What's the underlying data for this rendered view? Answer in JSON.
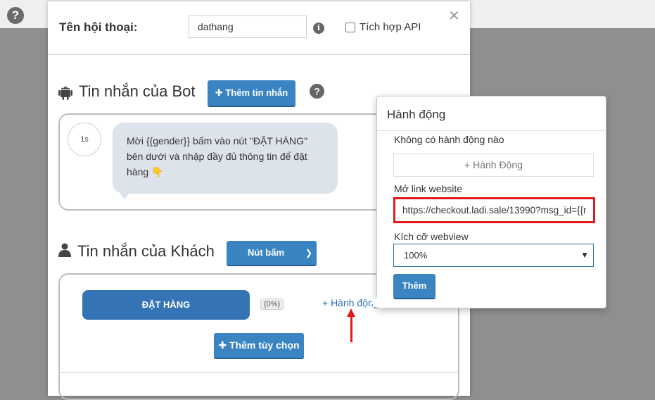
{
  "header": {
    "name_label": "Tên hội thoại:",
    "name_value": "dathang",
    "api_label": "Tích hợp API",
    "close_symbol": "✕"
  },
  "bot_section": {
    "title": "Tin nhắn của Bot",
    "add_button": "Thêm tin nhắn",
    "delay": "1s",
    "message_lines": [
      "Mời {{gender}} bấm vào nút \"ĐẶT HÀNG\"",
      "bên dưới và nhập đầy đủ thông tin để đặt",
      "hàng 👇"
    ]
  },
  "customer_section": {
    "title": "Tin nhắn của Khách",
    "type_select": "Nút bấm",
    "order_button": "ĐẶT HÀNG",
    "percent": "(0%)",
    "action_link": "+ Hành động",
    "add_option_button": "Thêm tùy chọn"
  },
  "popover": {
    "title": "Hành động",
    "no_action_text": "Không có hành động nào",
    "add_action_button": "+ Hành Động",
    "link_label": "Mở link website",
    "link_value": "https://checkout.ladi.sale/13990?msg_id={{m",
    "webview_label": "Kích cỡ webview",
    "webview_value": "100%",
    "submit_button": "Thêm"
  },
  "colors": {
    "primary_blue": "#3a84c1",
    "highlight_red": "#e01a1a",
    "bubble_bg": "#dde3ea"
  }
}
